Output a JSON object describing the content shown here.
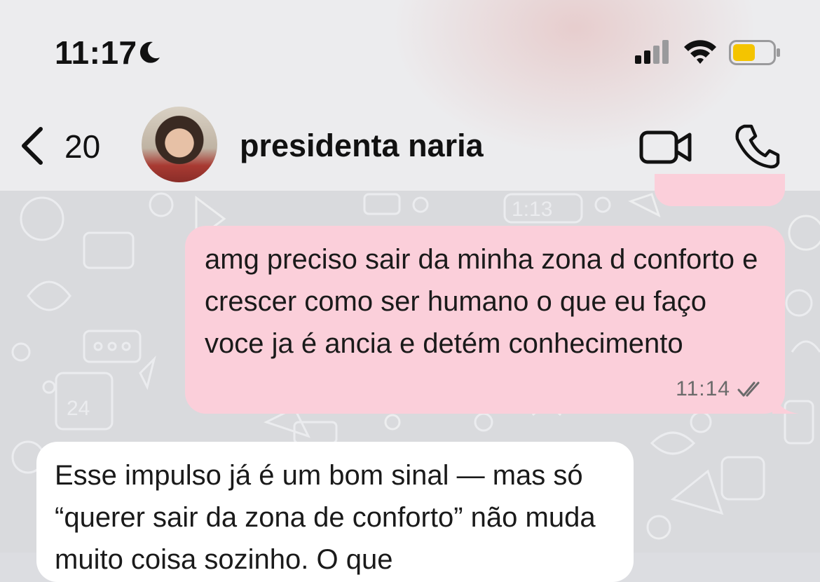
{
  "status_bar": {
    "time": "11:17",
    "icons": [
      "moon-icon",
      "cellular-signal-icon",
      "wifi-icon",
      "battery-icon"
    ],
    "battery_color": "#f4c400"
  },
  "chat_header": {
    "back_count": "20",
    "contact_name": "presidenta naria",
    "icons": [
      "back-chevron-icon",
      "video-call-icon",
      "phone-call-icon"
    ]
  },
  "messages": [
    {
      "direction": "outgoing",
      "text": "amg preciso sair da minha zona d conforto e crescer como ser humano o que eu faço voce ja é ancia e detém conhecimento",
      "time": "11:14",
      "status_icon": "double-check-icon"
    },
    {
      "direction": "incoming",
      "text": "Esse impulso já é um bom sinal — mas só “querer sair da zona de conforto” não muda muito coisa sozinho. O que"
    }
  ],
  "colors": {
    "outgoing_bubble": "#fbcfda",
    "incoming_bubble": "#ffffff",
    "wallpaper": "#d9dadd"
  }
}
